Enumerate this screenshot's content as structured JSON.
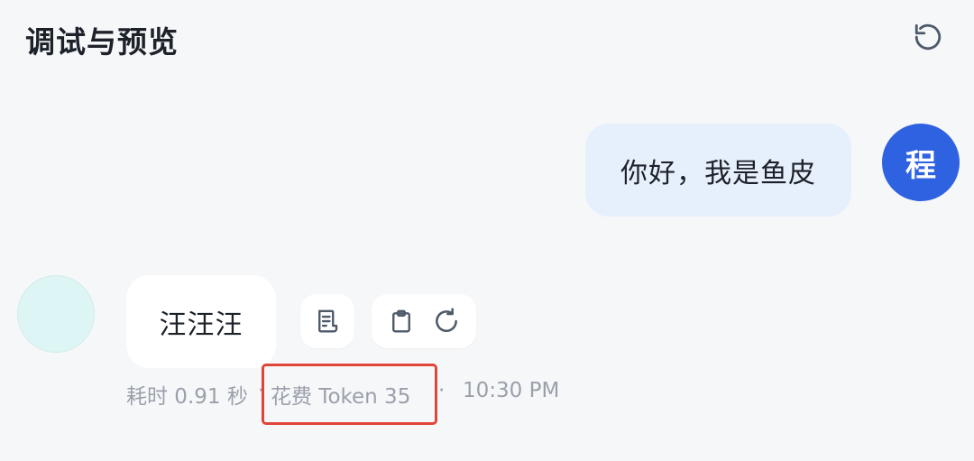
{
  "header": {
    "title": "调试与预览",
    "reset_icon": "refresh-ccw-icon"
  },
  "messages": {
    "user": {
      "avatar_text": "程",
      "avatar_color": "#2e62e0",
      "text": "你好，我是鱼皮"
    },
    "bot": {
      "avatar_color": "#ddf5f4",
      "text": "汪汪汪",
      "actions": {
        "log_icon": "document-log-icon",
        "copy_icon": "clipboard-icon",
        "regenerate_icon": "refresh-icon"
      },
      "meta": {
        "time_used": "耗时 0.91 秒",
        "separator_1": "·",
        "token_cost": "花费 Token 35",
        "separator_2": "·",
        "timestamp": "10:30 PM"
      }
    }
  },
  "highlight_color": "#e0453a"
}
